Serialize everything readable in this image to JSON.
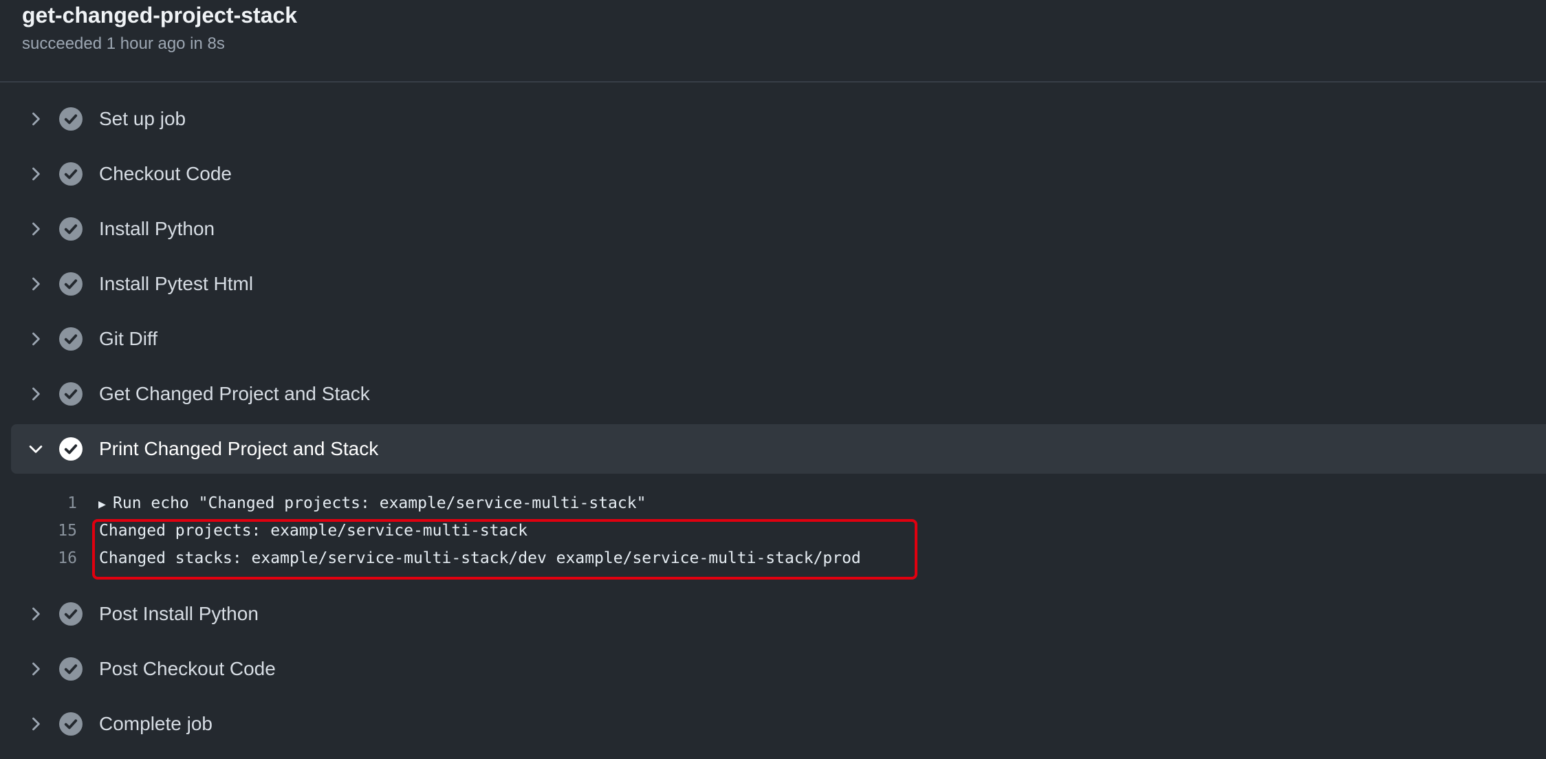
{
  "job": {
    "title": "get-changed-project-stack",
    "status": "succeeded 1 hour ago in 8s"
  },
  "icons": {
    "chevron_collapsed": "chevron-right-icon",
    "chevron_expanded": "chevron-down-icon",
    "step_status": "check-circle-icon"
  },
  "colors": {
    "background": "#24292f",
    "expanded_row": "#32383f",
    "success_icon_fill": "#8b949e",
    "expanded_icon_fill": "#ffffff",
    "annotation_border": "#e0000f"
  },
  "steps": [
    {
      "label": "Set up job",
      "status": "success",
      "expanded": false
    },
    {
      "label": "Checkout Code",
      "status": "success",
      "expanded": false
    },
    {
      "label": "Install Python",
      "status": "success",
      "expanded": false
    },
    {
      "label": "Install Pytest Html",
      "status": "success",
      "expanded": false
    },
    {
      "label": "Git Diff",
      "status": "success",
      "expanded": false
    },
    {
      "label": "Get Changed Project and Stack",
      "status": "success",
      "expanded": false
    },
    {
      "label": "Print Changed Project and Stack",
      "status": "success",
      "expanded": true
    },
    {
      "label": "Post Install Python",
      "status": "success",
      "expanded": false
    },
    {
      "label": "Post Checkout Code",
      "status": "success",
      "expanded": false
    },
    {
      "label": "Complete job",
      "status": "success",
      "expanded": false
    }
  ],
  "log": [
    {
      "number": "1",
      "text": "Run echo \"Changed projects: example/service-multi-stack\"",
      "collapsible": true
    },
    {
      "number": "15",
      "text": "Changed projects: example/service-multi-stack",
      "collapsible": false
    },
    {
      "number": "16",
      "text": "Changed stacks: example/service-multi-stack/dev example/service-multi-stack/prod",
      "collapsible": false
    }
  ]
}
